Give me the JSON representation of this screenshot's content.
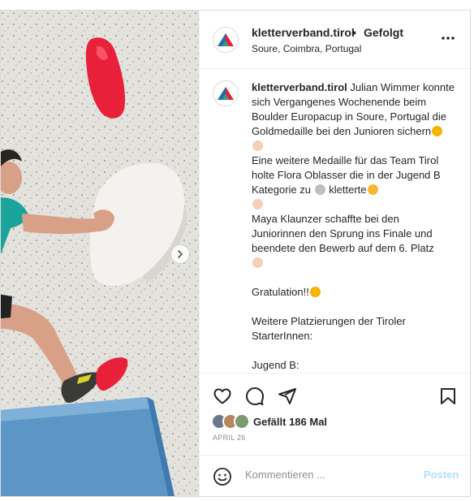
{
  "post": {
    "username": "kletterverband.tirol",
    "separator": "•",
    "follow_status": "Gefolgt",
    "location": "Soure, Coimbra, Portugal",
    "more_icon": "more-horizontal-icon",
    "avatar_icon": "kletterverband-logo"
  },
  "caption": {
    "username": "kletterverband.tirol",
    "lines": [
      "Julian Wimmer konnte sich Vergangenes Wochenende beim Boulder Europacup in Soure, Portugal die Goldmedaille bei den Junioren sichern",
      "Eine weitere Medaille für das Team Tirol holte Flora Oblasser die in der Jugend B Kategorie zu",
      "kletterte",
      "Maya Klaunzer schaffte bei den Juniorinnen den Sprung ins Finale und beendete den Bewerb auf dem 6. Platz",
      "Gratulation!!",
      "Weitere Platzierungen der Tiroler StarterInnen:",
      "Jugend B:"
    ]
  },
  "actions": {
    "icons": [
      "heart-icon",
      "comment-icon",
      "share-icon",
      "bookmark-icon"
    ],
    "likes_text": "Gefällt 186 Mal",
    "date": "APRIL 26"
  },
  "comment": {
    "placeholder": "Kommentieren ...",
    "post_label": "Posten",
    "emoji_icon": "smiley-icon"
  },
  "colors": {
    "post_button": "#b2dffc",
    "border": "#dbdbdb",
    "secondary_text": "#8e8e8e",
    "hold_red": "#e8203a",
    "mat_blue": "#5b96c6"
  }
}
